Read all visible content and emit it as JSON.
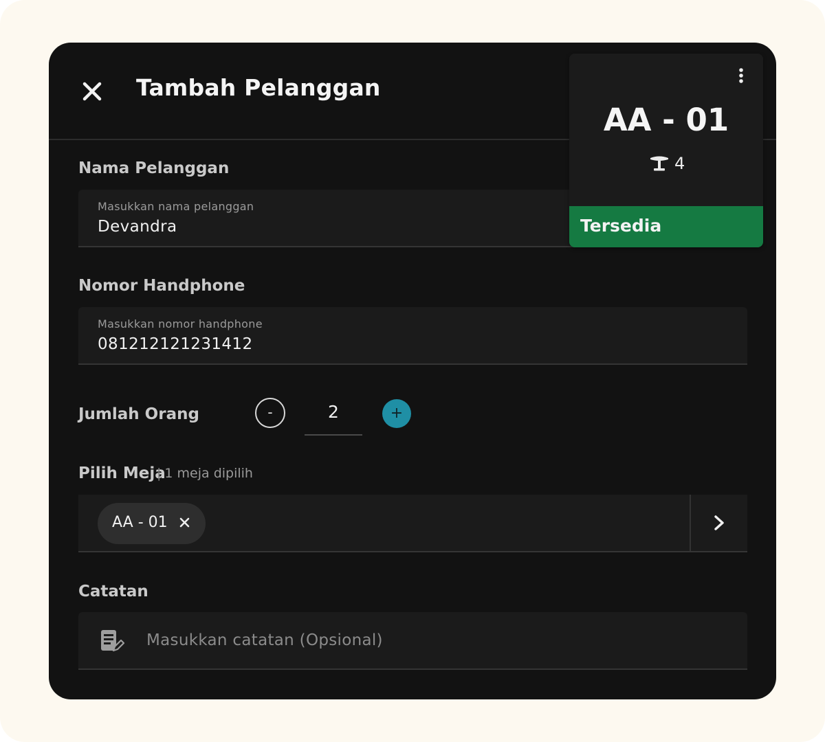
{
  "header": {
    "title": "Tambah Pelanggan",
    "close_icon": "close-icon"
  },
  "customer_name": {
    "label": "Nama Pelanggan",
    "placeholder": "Masukkan nama pelanggan",
    "value": "Devandra"
  },
  "phone": {
    "label": "Nomor Handphone",
    "placeholder": "Masukkan nomor handphone",
    "value": "081212121231412"
  },
  "people": {
    "label": "Jumlah Orang",
    "minus_label": "-",
    "value": "2",
    "plus_label": "+",
    "plus_color": "#1f8fa5"
  },
  "table_select": {
    "label": "Pilih Meja",
    "separator": "|",
    "count_text": "1 meja dipilih",
    "chips": [
      {
        "label": "AA - 01",
        "remove_icon": "close-icon"
      }
    ],
    "arrow_icon": "chevron-right-icon"
  },
  "notes": {
    "label": "Catatan",
    "placeholder": "Masukkan catatan (Opsional)",
    "icon": "note-edit-icon"
  },
  "table_card": {
    "code": "AA - 01",
    "seats": "4",
    "seat_icon": "table-icon",
    "menu_icon": "more-vertical-icon",
    "status": "Tersedia",
    "status_color": "#157a42"
  }
}
